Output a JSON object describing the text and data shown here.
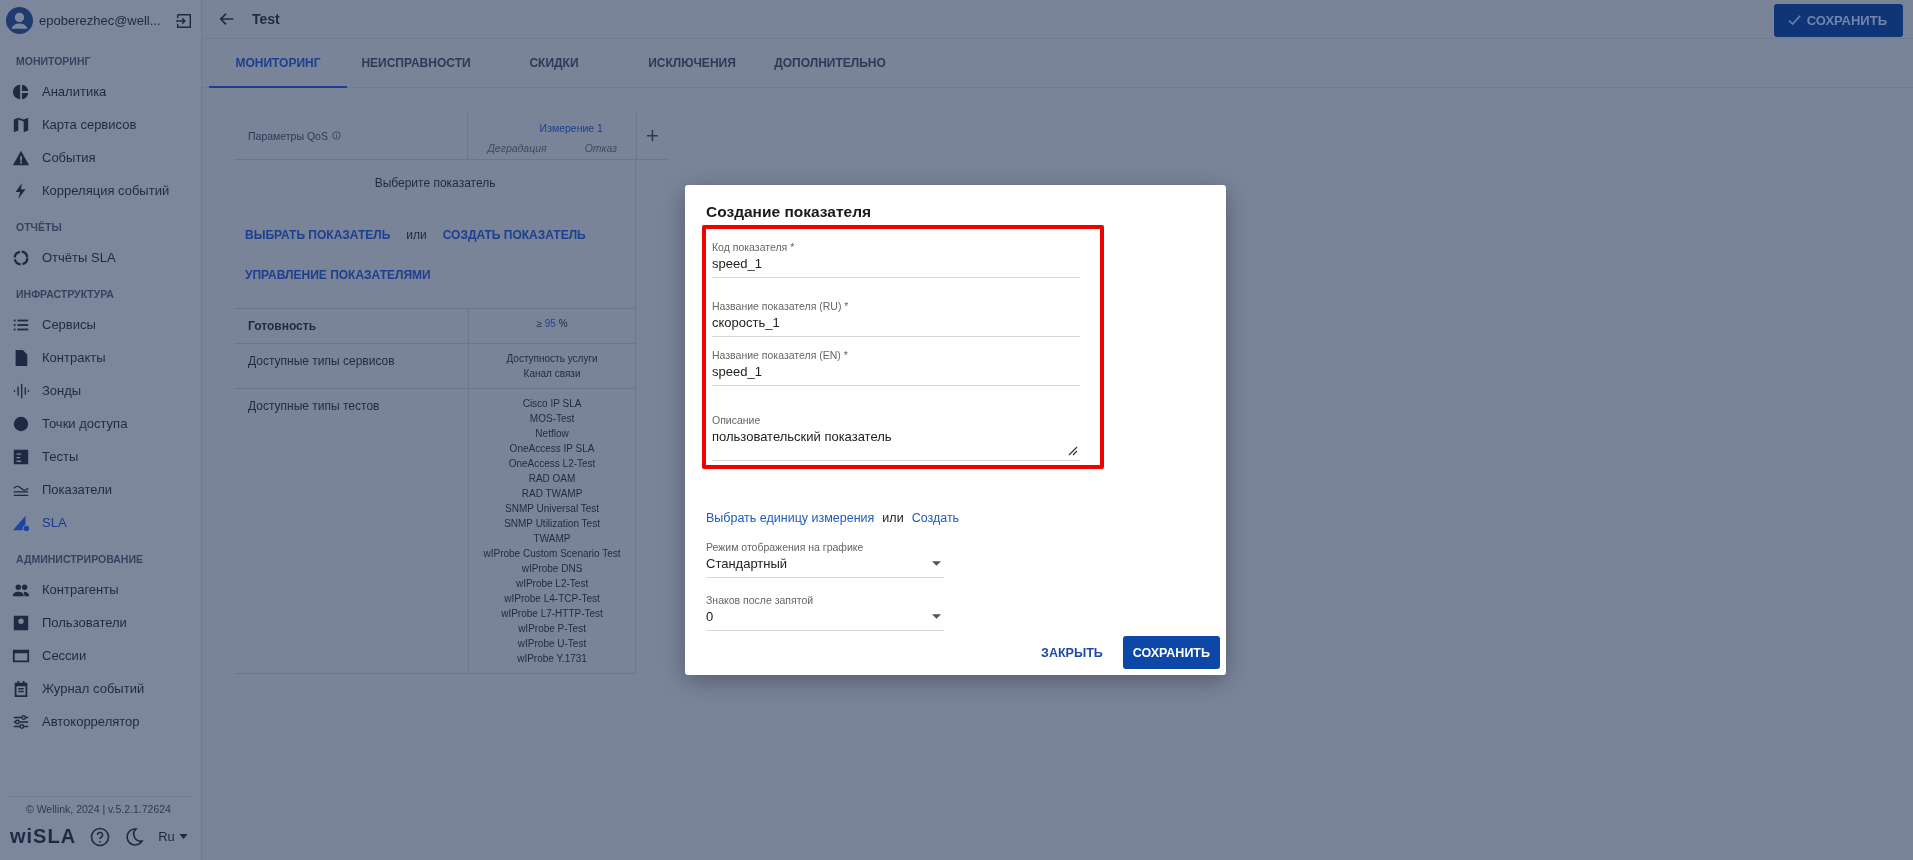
{
  "user": {
    "email": "epoberezhec@well..."
  },
  "sidebar": {
    "sections": [
      {
        "title": "МОНИТОРИНГ",
        "items": [
          {
            "label": "Аналитика",
            "selected": false
          },
          {
            "label": "Карта сервисов",
            "selected": false
          },
          {
            "label": "События",
            "selected": false
          },
          {
            "label": "Корреляция событий",
            "selected": false
          }
        ]
      },
      {
        "title": "ОТЧЁТЫ",
        "items": [
          {
            "label": "Отчёты SLA",
            "selected": false
          }
        ]
      },
      {
        "title": "ИНФРАСТРУКТУРА",
        "items": [
          {
            "label": "Сервисы",
            "selected": false
          },
          {
            "label": "Контракты",
            "selected": false
          },
          {
            "label": "Зонды",
            "selected": false
          },
          {
            "label": "Точки доступа",
            "selected": false
          },
          {
            "label": "Тесты",
            "selected": false
          },
          {
            "label": "Показатели",
            "selected": false
          },
          {
            "label": "SLA",
            "selected": true
          }
        ]
      },
      {
        "title": "АДМИНИСТРИРОВАНИЕ",
        "items": [
          {
            "label": "Контрагенты",
            "selected": false
          },
          {
            "label": "Пользователи",
            "selected": false
          },
          {
            "label": "Сессии",
            "selected": false
          },
          {
            "label": "Журнал событий",
            "selected": false
          },
          {
            "label": "Автокоррелятор",
            "selected": false
          }
        ]
      }
    ],
    "copyright": "© Wellink, 2024 | v.5.2.1.72624",
    "logo": "wiSLA",
    "language": "Ru"
  },
  "header": {
    "title": "Test",
    "save_button": "СОХРАНИТЬ"
  },
  "tabs": [
    {
      "label": "МОНИТОРИНГ",
      "selected": true
    },
    {
      "label": "НЕИСПРАВНОСТИ",
      "selected": false
    },
    {
      "label": "СКИДКИ",
      "selected": false
    },
    {
      "label": "ИСКЛЮЧЕНИЯ",
      "selected": false
    },
    {
      "label": "ДОПОЛНИТЕЛЬНО",
      "selected": false
    }
  ],
  "table": {
    "param_header": "Параметры QoS",
    "measurement": "Измерение 1",
    "subcolumns": [
      "Деградация",
      "Отказ"
    ],
    "add": "+",
    "placeholder": "Выберите показатель",
    "actions": {
      "select": "ВЫБРАТЬ ПОКАЗАТЕЛЬ",
      "or": "или",
      "create": "СОЗДАТЬ ПОКАЗАТЕЛЬ",
      "manage": "УПРАВЛЕНИЕ ПОКАЗАТЕЛЯМИ"
    },
    "rows": [
      {
        "kind": "threshold",
        "label": "Готовность",
        "prefix": "≥",
        "value": "95",
        "suffix": "%"
      },
      {
        "kind": "list",
        "label": "Доступные типы сервисов",
        "values": [
          "Доступность услуги",
          "Канал связи"
        ]
      },
      {
        "kind": "list",
        "label": "Доступные типы тестов",
        "values": [
          "Cisco IP SLA",
          "MOS-Test",
          "Netflow",
          "OneAccess IP SLA",
          "OneAccess L2-Test",
          "RAD OAM",
          "RAD TWAMP",
          "SNMP Universal Test",
          "SNMP Utilization Test",
          "TWAMP",
          "wIProbe Custom Scenario Test",
          "wIProbe DNS",
          "wIProbe L2-Test",
          "wIProbe L4-TCP-Test",
          "wIProbe L7-HTTP-Test",
          "wIProbe P-Test",
          "wIProbe U-Test",
          "wIProbe Y.1731"
        ]
      }
    ]
  },
  "dialog": {
    "title": "Создание показателя",
    "fields": [
      {
        "kind": "text",
        "label": "Код показателя *",
        "value": "speed_1"
      },
      {
        "kind": "text",
        "label": "Название показателя (RU) *",
        "value": "скорость_1"
      },
      {
        "kind": "text",
        "label": "Название показателя (EN) *",
        "value": "speed_1"
      },
      {
        "kind": "textarea",
        "label": "Описание",
        "value": "пользовательский показатель"
      }
    ],
    "unit": {
      "select": "Выбрать единицу измерения",
      "or": "или",
      "create": "Создать"
    },
    "selects": [
      {
        "label": "Режим отображения на графике",
        "value": "Стандартный"
      },
      {
        "label": "Знаков после запятой",
        "value": "0"
      }
    ],
    "close_button": "ЗАКРЫТЬ",
    "save_button": "СОХРАНИТЬ"
  }
}
